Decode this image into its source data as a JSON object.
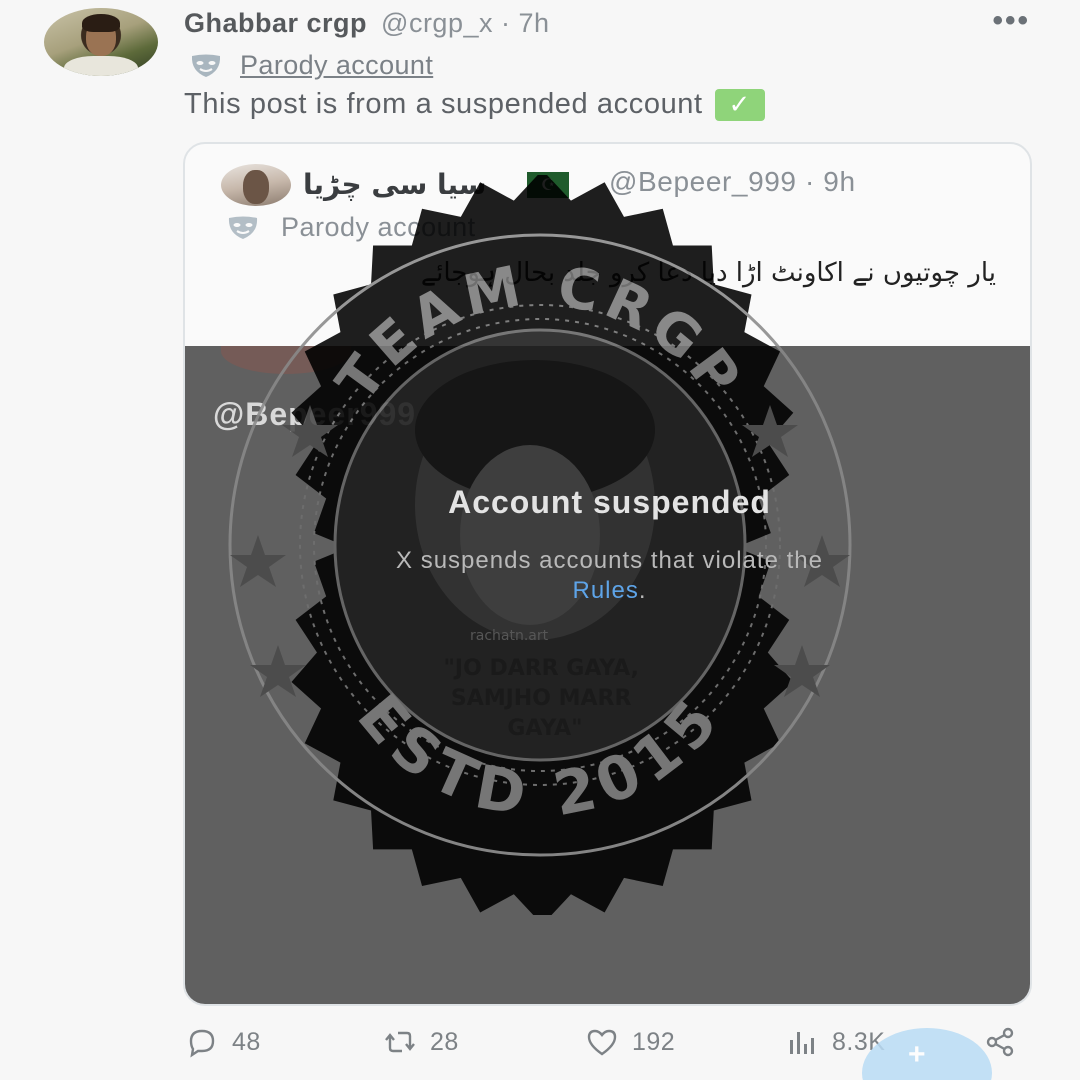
{
  "post": {
    "display_name": "Ghabbar crgp",
    "handle_time": "@crgp_x · 7h",
    "parody_label": "Parody account",
    "text": "This post is from a suspended account",
    "check_glyph": "✓",
    "more_glyph": "•••"
  },
  "quoted": {
    "name": "سیا سی چڑیا",
    "flag_glyph": "☪",
    "handle_time": "@Bepeer_999 · 9h",
    "parody_label": "Parody account",
    "text": "یار چوتیوں نے اکاونٹ اڑا دیا دعا کرو جلد بحال ہوجائے"
  },
  "media": {
    "overlay_handle": "@Bepeer999",
    "suspended_title": "Account suspended",
    "suspended_sub_prefix": "X suspends accounts that violate the",
    "suspended_link": "Rules",
    "suspended_sub_suffix": "."
  },
  "watermark": {
    "top_text": "TEAM CRGP",
    "bottom_text": "ESTD 2015",
    "quote_text": "\"JO DARR GAYA, SAMJHO MARR GAYA\"",
    "artist_text": "rachatn.art"
  },
  "actions": {
    "replies": "48",
    "reposts": "28",
    "likes": "192",
    "views": "8.3K"
  },
  "colors": {
    "accent": "#1d9bf0",
    "check_green": "#8fd47a",
    "media_grey": "#606060"
  },
  "icons": [
    "mask-icon",
    "check-icon",
    "more-icon",
    "flag-icon",
    "reply-icon",
    "repost-icon",
    "like-icon",
    "views-icon",
    "share-icon",
    "compose-icon"
  ]
}
